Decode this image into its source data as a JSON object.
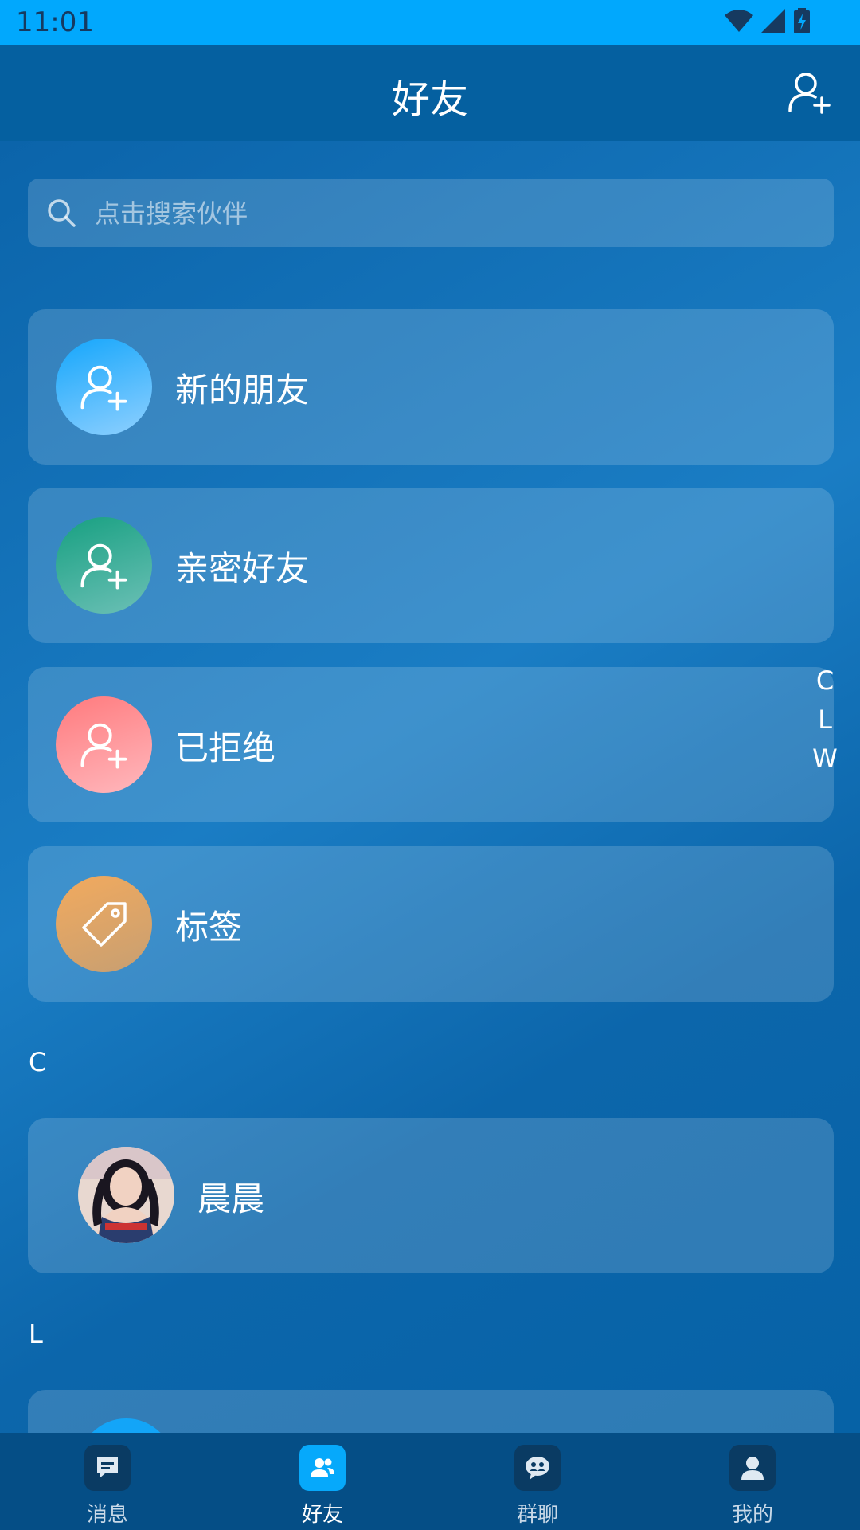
{
  "status_bar": {
    "time": "11:01"
  },
  "header": {
    "title": "好友"
  },
  "search": {
    "placeholder": "点击搜索伙伴"
  },
  "menu_cards": [
    {
      "label": "新的朋友",
      "icon": "add-user-icon",
      "color": "#38aef6"
    },
    {
      "label": "亲密好友",
      "icon": "add-user-icon",
      "color": "#2aa58a"
    },
    {
      "label": "已拒绝",
      "icon": "add-user-icon",
      "color": "#ff8a8e"
    },
    {
      "label": "标签",
      "icon": "tag-icon",
      "color": "#e5a25e"
    }
  ],
  "sections": [
    {
      "letter": "C",
      "friends": [
        {
          "name": "晨晨"
        }
      ]
    },
    {
      "letter": "L",
      "friends": [
        {
          "name": ""
        }
      ]
    }
  ],
  "index_letters": [
    "C",
    "L",
    "W"
  ],
  "bottom_nav": [
    {
      "label": "消息",
      "icon": "message-icon"
    },
    {
      "label": "好友",
      "icon": "friends-icon",
      "active": true
    },
    {
      "label": "群聊",
      "icon": "group-chat-icon"
    },
    {
      "label": "我的",
      "icon": "profile-icon"
    }
  ]
}
